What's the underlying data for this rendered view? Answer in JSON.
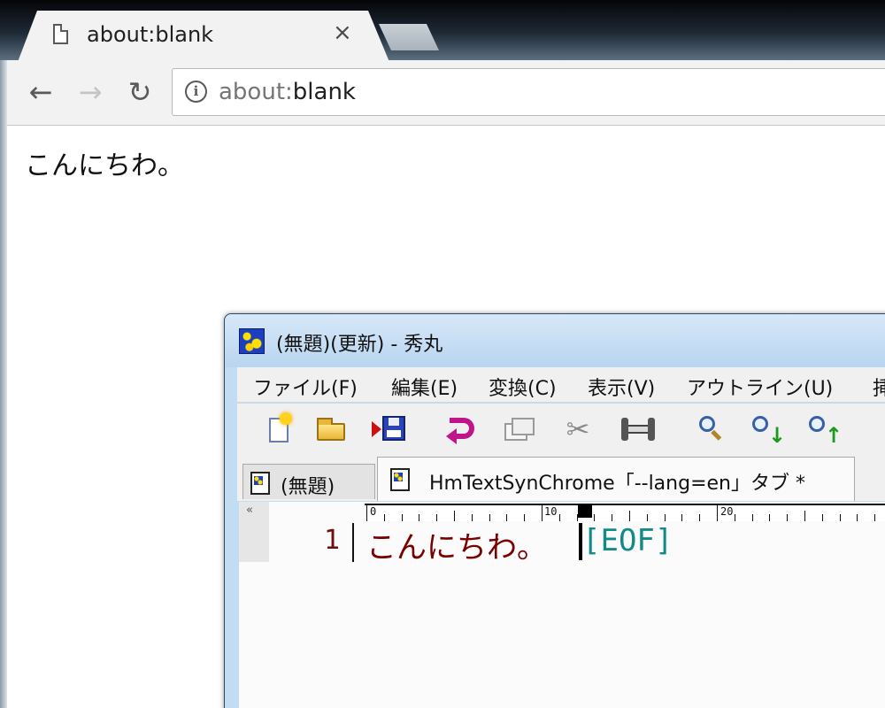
{
  "browser": {
    "tab": {
      "title": "about:blank",
      "close_glyph": "×",
      "icon": "page-icon"
    },
    "nav": {
      "back_glyph": "←",
      "forward_glyph": "→",
      "reload_glyph": "↻"
    },
    "omnibox": {
      "info_glyph": "i",
      "scheme": "about:",
      "host": "blank"
    },
    "page": {
      "text": "こんにちわ。"
    }
  },
  "editor": {
    "title": "(無題)(更新) - 秀丸",
    "menu": [
      {
        "label": "ファイル(F)"
      },
      {
        "label": "編集(E)"
      },
      {
        "label": "変換(C)"
      },
      {
        "label": "表示(V)"
      },
      {
        "label": "アウトライン(U)"
      },
      {
        "label": "挿"
      }
    ],
    "toolbar_icons": [
      "new-file-icon",
      "open-folder-icon",
      "save-icon",
      "undo-icon",
      "copy-icon",
      "cut-icon",
      "paste-icon",
      "search-icon",
      "search-next-icon",
      "search-previous-icon"
    ],
    "tabs": [
      {
        "label": "(無題)"
      },
      {
        "label": "HmTextSynChrome「--lang=en」タブ *"
      }
    ],
    "ruler": {
      "collapse_glyph": "«",
      "labels": [
        "0",
        "10",
        "20"
      ]
    },
    "line_number": "1",
    "text": "こんにちわ。",
    "eof": "[EOF]"
  },
  "colors": {
    "editor_text": "#7a0000",
    "eof": "#138a8a",
    "line_number": "#6a1010"
  }
}
